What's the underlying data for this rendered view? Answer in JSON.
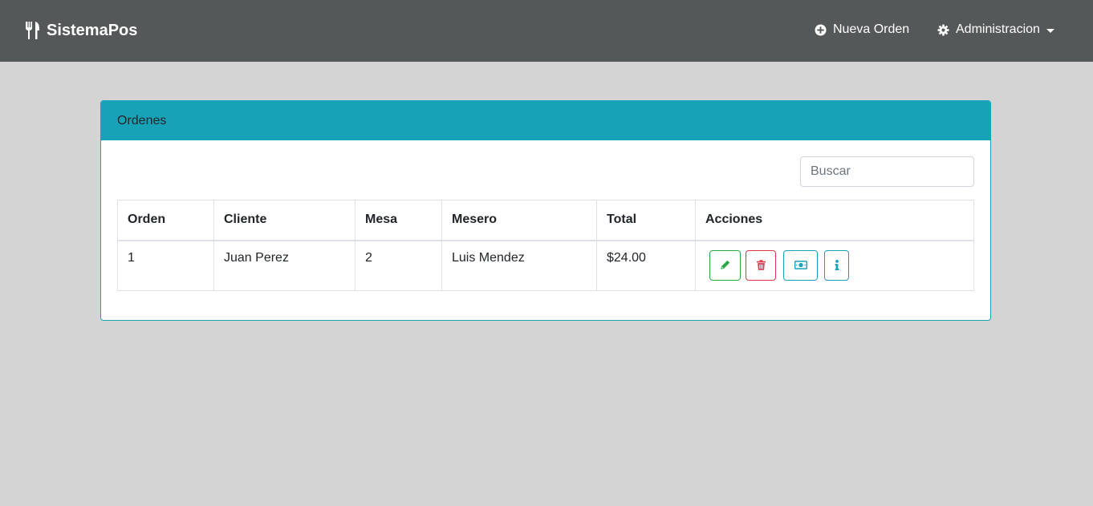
{
  "navbar": {
    "brand": "SistemaPos",
    "brand_icon": "utensils-icon",
    "new_order": "Nueva Orden",
    "new_order_icon": "plus-circle-icon",
    "admin": "Administracion",
    "admin_icon": "gear-icon"
  },
  "card": {
    "title": "Ordenes",
    "search_placeholder": "Buscar",
    "headers": [
      "Orden",
      "Cliente",
      "Mesa",
      "Mesero",
      "Total",
      "Acciones"
    ],
    "rows": [
      {
        "orden": "1",
        "cliente": "Juan Perez",
        "mesa": "2",
        "mesero": "Luis Mendez",
        "total": "$24.00",
        "actions": [
          "edit-icon",
          "trash-icon",
          "money-icon",
          "info-icon"
        ]
      }
    ]
  },
  "colors": {
    "navbar_bg": "#555859",
    "page_bg": "#d4d4d4",
    "card_accent": "#17a2b8",
    "success": "#28a745",
    "danger": "#dc3545",
    "info": "#17a2b8"
  }
}
